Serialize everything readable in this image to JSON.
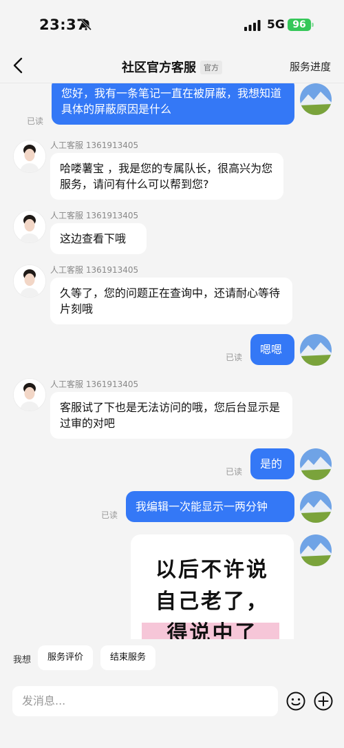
{
  "status_bar": {
    "time": "23:37",
    "network": "5G",
    "battery": "96"
  },
  "nav": {
    "title": "社区官方客服",
    "badge": "官方",
    "right_action": "服务进度"
  },
  "messages": {
    "m1": {
      "text": "您好，我有一条笔记一直在被屏蔽，我想知道具体的屏蔽原因是什么",
      "read": "已读"
    },
    "m2": {
      "sender": "人工客服 1361913405",
      "text": "哈喽薯宝 ，我是您的专属队长，很高兴为您服务，请问有什么可以帮到您?"
    },
    "m3": {
      "sender": "人工客服 1361913405",
      "text": "这边查看下哦"
    },
    "m4": {
      "sender": "人工客服 1361913405",
      "text": "久等了，您的问题正在查询中，还请耐心等待片刻哦"
    },
    "m5": {
      "text": "嗯嗯",
      "read": "已读"
    },
    "m6": {
      "sender": "人工客服 1361913405",
      "text": "客服试了下也是无法访问的哦，您后台显示是过审的对吧"
    },
    "m7": {
      "text": "是的",
      "read": "已读"
    },
    "m8": {
      "text": "我编辑一次能显示一两分钟",
      "read": "已读"
    },
    "sticker": {
      "line1": "以后不许说",
      "line2": "自己老了，",
      "line3": "得说中了"
    }
  },
  "bottom": {
    "quick_label": "我想",
    "quick_actions": [
      "服务评价",
      "结束服务"
    ],
    "input_placeholder": "发消息..."
  },
  "colors": {
    "accent": "#3478f6",
    "battery": "#35c759",
    "sticker_highlight": "#f6c6d8"
  }
}
